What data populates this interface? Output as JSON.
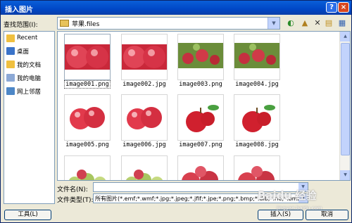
{
  "window": {
    "title": "插入图片",
    "help_label": "?",
    "close_label": "×"
  },
  "lookin": {
    "label": "查找范围(I):",
    "value": "苹果.files"
  },
  "toolbar": {
    "back_label": "◐",
    "up_label": "▲",
    "delete_label": "✕",
    "newfolder_label": "▤",
    "views_label": "▦"
  },
  "sidebar": {
    "items": [
      {
        "label": "Recent",
        "icon": "recent-icon",
        "color": "#f0c040"
      },
      {
        "label": "桌面",
        "icon": "desktop-icon",
        "color": "#3a73c9"
      },
      {
        "label": "我的文档",
        "icon": "my-documents-icon",
        "color": "#f0c040"
      },
      {
        "label": "我的电脑",
        "icon": "my-computer-icon",
        "color": "#8ca9d6"
      },
      {
        "label": "网上邻居",
        "icon": "network-places-icon",
        "color": "#4d87c7"
      }
    ]
  },
  "files": [
    {
      "name": "image001.png",
      "art": "apples-red-closeup",
      "selected": true
    },
    {
      "name": "image002.jpg",
      "art": "apples-red-closeup"
    },
    {
      "name": "image003.png",
      "art": "apples-tree"
    },
    {
      "name": "image004.jpg",
      "art": "apples-tree"
    },
    {
      "name": "image005.png",
      "art": "apples-pair"
    },
    {
      "name": "image006.jpg",
      "art": "apples-pair"
    },
    {
      "name": "image007.png",
      "art": "apple-leaf"
    },
    {
      "name": "image008.jpg",
      "art": "apple-leaf"
    },
    {
      "name": "",
      "art": "apples-green"
    },
    {
      "name": "",
      "art": "apples-green"
    },
    {
      "name": "",
      "art": "apples-mixed"
    },
    {
      "name": "",
      "art": "apples-mixed"
    }
  ],
  "filename": {
    "label": "文件名(N):",
    "value": ""
  },
  "filetype": {
    "label": "文件类型(T):",
    "value": "所有图片(*.emf;*.wmf;*.jpg;*.jpeg;*.jfif;*.jpe;*.png;*.bmp;*.dib;*.rle;*.bmz"
  },
  "buttons": {
    "tools": "工具(L)",
    "insert": "插入(S)",
    "cancel": "取消"
  },
  "watermark": {
    "main": "Baidu 经验",
    "sub": "jingyan.baidu.com"
  }
}
